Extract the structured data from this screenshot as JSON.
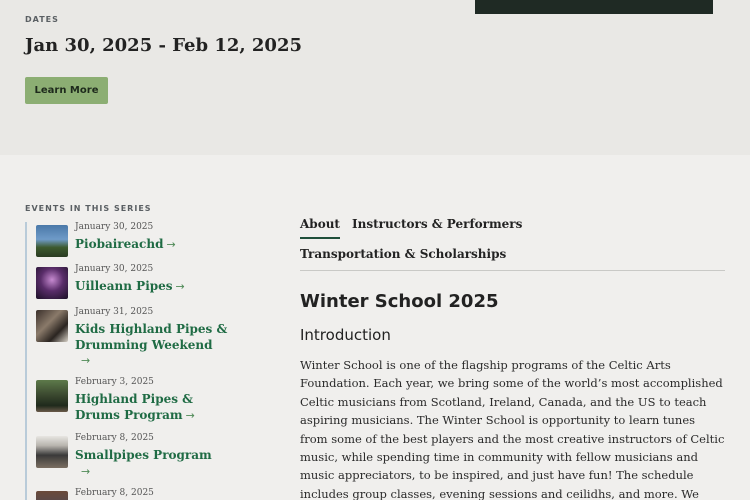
{
  "hero": {
    "dates_label": "DATES",
    "dates_value": "Jan 30, 2025 - Feb 12, 2025",
    "learn_more": "Learn More"
  },
  "series": {
    "label": "EVENTS IN THIS SERIES",
    "events": [
      {
        "date": "January 30, 2025",
        "title": "Piobaireachd"
      },
      {
        "date": "January 30, 2025",
        "title": "Uilleann Pipes"
      },
      {
        "date": "January 31, 2025",
        "title": "Kids Highland Pipes & Drumming Weekend"
      },
      {
        "date": "February 3, 2025",
        "title": "Highland Pipes & Drums Program"
      },
      {
        "date": "February 8, 2025",
        "title": "Smallpipes Program"
      },
      {
        "date": "February 8, 2025",
        "title": ""
      }
    ],
    "arrow_glyph": "→"
  },
  "tabs": {
    "about": "About",
    "instructors": "Instructors & Performers",
    "transport": "Transportation & Scholarships"
  },
  "content": {
    "title": "Winter School 2025",
    "subtitle": "Introduction",
    "body": "Winter School is one of the flagship programs of the Celtic Arts Foundation. Each year, we bring some of the world’s most accomplished Celtic musicians from Scotland, Ireland, Canada, and the US to teach aspiring musicians. The Winter School is opportunity to learn tunes from some of the best players and the most creative instructors of Celtic music, while spending time in community with fellow musicians and music appreciators, to be inspired, and just have fun! The schedule includes group classes, evening sessions and ceilidhs, and more. We welcome all"
  }
}
